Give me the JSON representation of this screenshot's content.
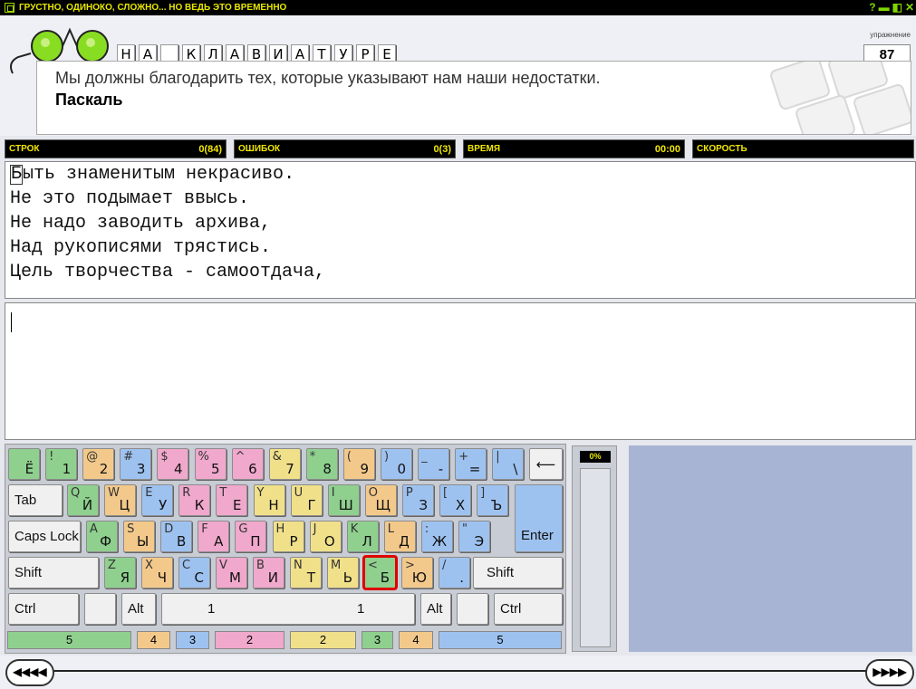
{
  "window": {
    "title": "ГРУСТНО, ОДИНОКО, СЛОЖНО... НО ВЕДЬ ЭТО ВРЕМЕННО",
    "help": "?",
    "minimize": "▬",
    "maximize": "◧",
    "close": "✕"
  },
  "header": {
    "letters": [
      "Н",
      "А",
      "",
      "К",
      "Л",
      "А",
      "В",
      "И",
      "А",
      "Т",
      "У",
      "Р",
      "Е"
    ],
    "exercise_label": "упражнение",
    "exercise_number": "87"
  },
  "quote": {
    "text": "Мы должны благодарить тех, которые указывают нам наши недостатки.",
    "author": "Паскаль"
  },
  "stats": [
    {
      "label": "СТРОК",
      "value": "0(84)"
    },
    {
      "label": "ОШИБОК",
      "value": "0(3)"
    },
    {
      "label": "ВРЕМЯ",
      "value": "00:00"
    },
    {
      "label": "СКОРОСТЬ",
      "value": ""
    }
  ],
  "text": {
    "first_char": "Б",
    "first_rest": "ыть знаменитым некрасиво.",
    "lines": [
      "Не это подымает ввысь.",
      "Не надо заводить архива,",
      "Над рукописями трястись.",
      "Цель творчества - самоотдача,"
    ]
  },
  "keyboard": {
    "row1": [
      {
        "top": "",
        "bot": "Ё",
        "color": "c-green"
      },
      {
        "top": "!",
        "bot": "1",
        "color": "c-green"
      },
      {
        "top": "@",
        "bot": "2",
        "color": "c-orange"
      },
      {
        "top": "#",
        "bot": "3",
        "color": "c-blue"
      },
      {
        "top": "$",
        "bot": "4",
        "color": "c-pink"
      },
      {
        "top": "%",
        "bot": "5",
        "color": "c-pink"
      },
      {
        "top": "^",
        "bot": "6",
        "color": "c-pink"
      },
      {
        "top": "&",
        "bot": "7",
        "color": "c-yellow"
      },
      {
        "top": "*",
        "bot": "8",
        "color": "c-green"
      },
      {
        "top": "(",
        "bot": "9",
        "color": "c-orange"
      },
      {
        "top": ")",
        "bot": "0",
        "color": "c-blue"
      },
      {
        "top": "_",
        "bot": "-",
        "color": "c-blue"
      },
      {
        "top": "+",
        "bot": "=",
        "color": "c-blue"
      },
      {
        "top": "|",
        "bot": "\\",
        "color": "c-blue"
      }
    ],
    "backspace": "⟵",
    "tab": "Tab",
    "row2": [
      {
        "top": "Q",
        "bot": "Й",
        "color": "c-green"
      },
      {
        "top": "W",
        "bot": "Ц",
        "color": "c-orange"
      },
      {
        "top": "E",
        "bot": "У",
        "color": "c-blue"
      },
      {
        "top": "R",
        "bot": "К",
        "color": "c-pink"
      },
      {
        "top": "T",
        "bot": "Е",
        "color": "c-pink"
      },
      {
        "top": "Y",
        "bot": "Н",
        "color": "c-yellow"
      },
      {
        "top": "U",
        "bot": "Г",
        "color": "c-yellow"
      },
      {
        "top": "I",
        "bot": "Ш",
        "color": "c-green"
      },
      {
        "top": "O",
        "bot": "Щ",
        "color": "c-orange"
      },
      {
        "top": "P",
        "bot": "З",
        "color": "c-blue"
      },
      {
        "top": "[",
        "bot": "Х",
        "color": "c-blue"
      },
      {
        "top": "]",
        "bot": "Ъ",
        "color": "c-blue"
      }
    ],
    "caps": "Caps Lock",
    "row3": [
      {
        "top": "A",
        "bot": "Ф",
        "color": "c-green"
      },
      {
        "top": "S",
        "bot": "Ы",
        "color": "c-orange"
      },
      {
        "top": "D",
        "bot": "В",
        "color": "c-blue"
      },
      {
        "top": "F",
        "bot": "А",
        "color": "c-pink"
      },
      {
        "top": "G",
        "bot": "П",
        "color": "c-pink"
      },
      {
        "top": "H",
        "bot": "Р",
        "color": "c-yellow"
      },
      {
        "top": "J",
        "bot": "О",
        "color": "c-yellow"
      },
      {
        "top": "K",
        "bot": "Л",
        "color": "c-green"
      },
      {
        "top": "L",
        "bot": "Д",
        "color": "c-orange"
      },
      {
        "top": ":",
        "bot": "Ж",
        "color": "c-blue"
      },
      {
        "top": "\"",
        "bot": "Э",
        "color": "c-blue"
      }
    ],
    "enter": "Enter",
    "shift_left": "Shift",
    "row4": [
      {
        "top": "Z",
        "bot": "Я",
        "color": "c-green"
      },
      {
        "top": "X",
        "bot": "Ч",
        "color": "c-orange"
      },
      {
        "top": "C",
        "bot": "С",
        "color": "c-blue"
      },
      {
        "top": "V",
        "bot": "М",
        "color": "c-pink"
      },
      {
        "top": "B",
        "bot": "И",
        "color": "c-pink"
      },
      {
        "top": "N",
        "bot": "Т",
        "color": "c-yellow"
      },
      {
        "top": "M",
        "bot": "Ь",
        "color": "c-yellow"
      },
      {
        "top": "<",
        "bot": "Б",
        "color": "c-green"
      },
      {
        "top": ">",
        "bot": "Ю",
        "color": "c-orange"
      },
      {
        "top": "/",
        "bot": ".",
        "color": "c-blue"
      }
    ],
    "shift_right": "Shift",
    "ctrl_left": "Ctrl",
    "alt_left": "Alt",
    "space_left": "1",
    "space_right": "1",
    "alt_right": "Alt",
    "ctrl_right": "Ctrl",
    "fingers": [
      "5",
      "4",
      "3",
      "2",
      "2",
      "3",
      "4",
      "5"
    ]
  },
  "meter": {
    "value": "0%"
  },
  "nav": {
    "prev": "◀◀◀◀",
    "next": "▶▶▶▶"
  }
}
